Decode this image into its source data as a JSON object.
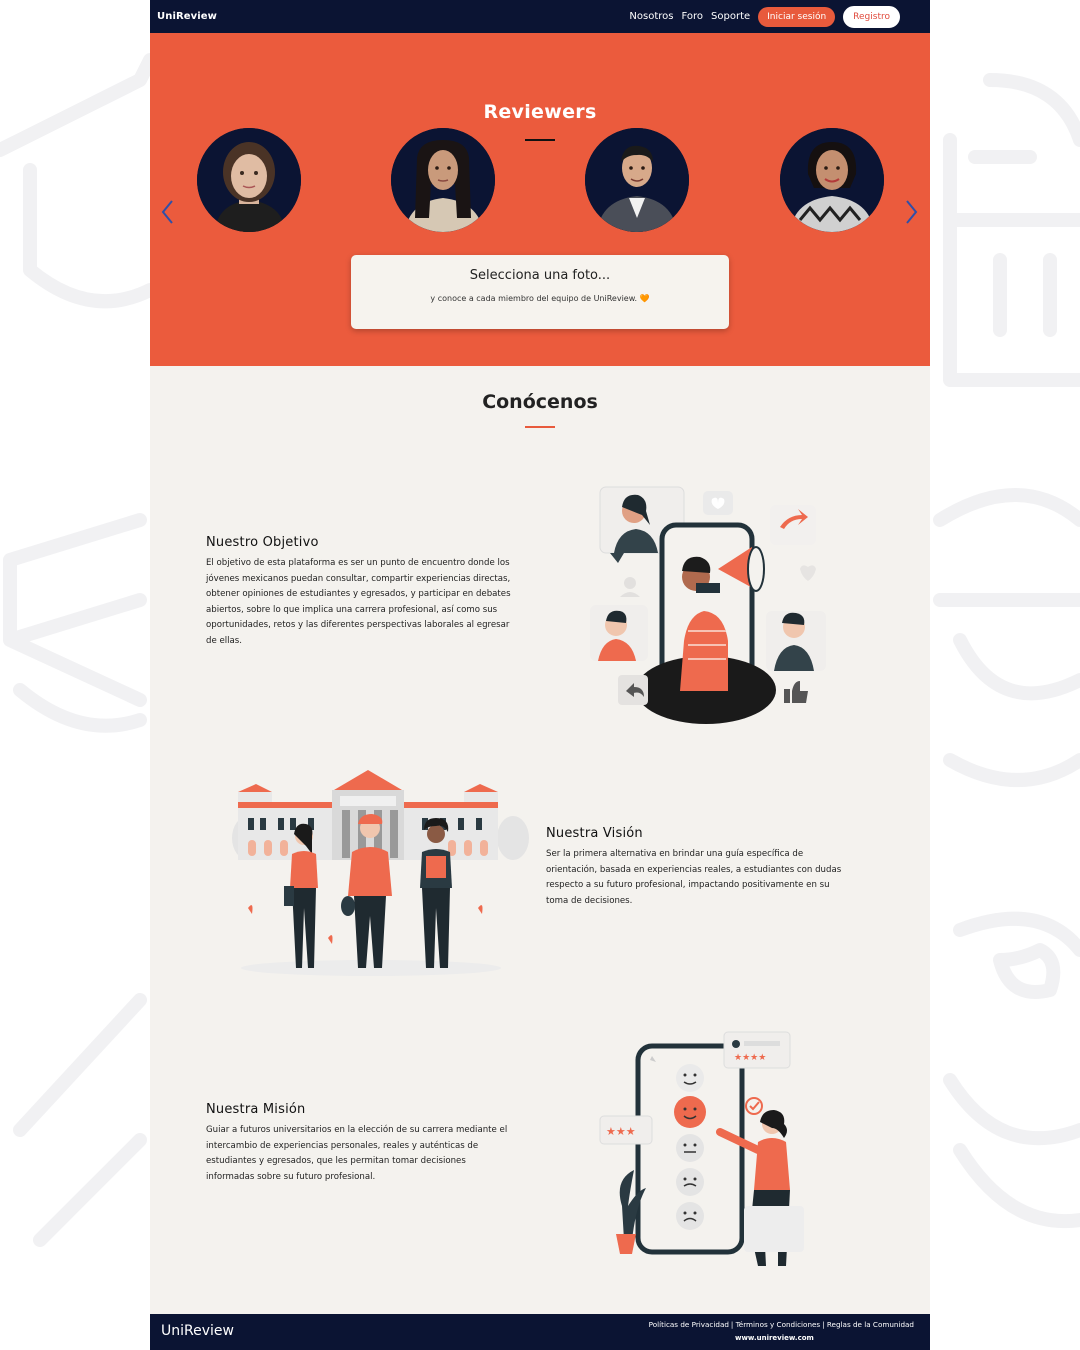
{
  "nav": {
    "brand": "UniReview",
    "links": [
      "Nosotros",
      "Foro",
      "Soporte"
    ],
    "login_label": "Iniciar sesión",
    "register_label": "Registro"
  },
  "hero": {
    "title": "Reviewers",
    "card_title": "Selecciona una foto...",
    "card_subtitle": "y conoce a cada miembro del equipo de UniReview. 🧡"
  },
  "about": {
    "title": "Conócenos",
    "objective": {
      "title": "Nuestro Objetivo",
      "lines": [
        "El objetivo de esta plataforma es ser un punto de encuentro donde los",
        "jóvenes mexicanos puedan consultar, compartir experiencias directas,",
        "obtener opiniones de estudiantes y egresados, y participar en debates",
        "abiertos, sobre lo que implica una carrera profesional, así como sus",
        "oportunidades, retos y las diferentes perspectivas laborales al egresar",
        "de ellas."
      ]
    },
    "vision": {
      "title": "Nuestra Visión",
      "lines": [
        "Ser la primera alternativa en brindar una guía específica de",
        "orientación, basada en experiencias reales, a estudiantes con dudas",
        "respecto a su futuro profesional, impactando positivamente en su",
        "toma de decisiones."
      ]
    },
    "mission": {
      "title": "Nuestra Misión",
      "lines": [
        "Guiar a futuros universitarios en la elección de su carrera mediante el",
        "intercambio de experiencias personales, reales y auténticas de",
        "estudiantes y egresados, que les permitan tomar decisiones",
        "informadas sobre su futuro profesional."
      ]
    }
  },
  "footer": {
    "brand": "UniReview",
    "links": [
      "Políticas de Privacidad",
      "Términos y Condiciones",
      "Reglas de la Comunidad"
    ],
    "url": "www.unireview.com"
  },
  "colors": {
    "accent": "#eb5b3d",
    "navy": "#0b1433",
    "page_bg": "#f4f2ee"
  }
}
